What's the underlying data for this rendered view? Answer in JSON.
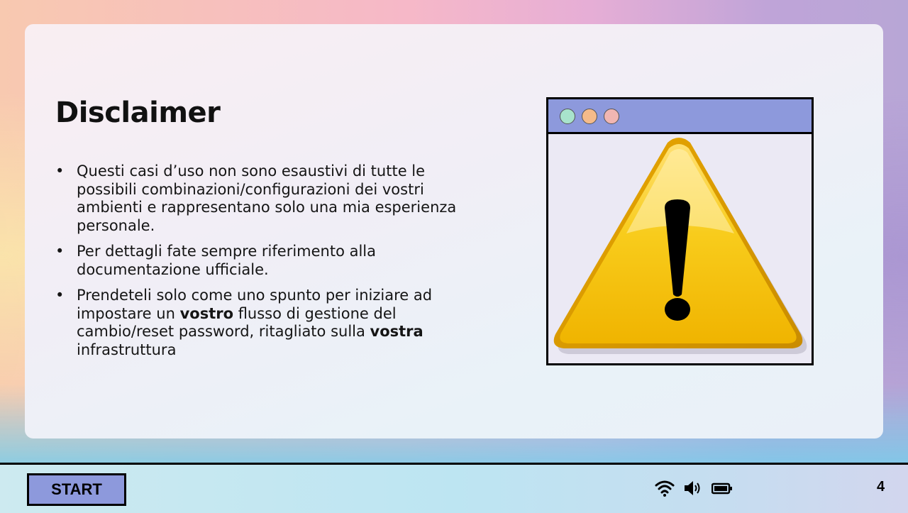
{
  "slide": {
    "title": "Disclaimer",
    "bullets": [
      {
        "parts": [
          {
            "text": "Questi casi d’uso non sono esaustivi di tutte le possibili combinazioni/configurazioni dei vostri ambienti e rappresentano solo una mia esperienza personale.",
            "bold": false
          }
        ]
      },
      {
        "parts": [
          {
            "text": "Per dettagli fate sempre riferimento alla documentazione ufficiale.",
            "bold": false
          }
        ]
      },
      {
        "parts": [
          {
            "text": "Prendeteli solo come uno spunto per iniziare ad impostare un ",
            "bold": false
          },
          {
            "text": "vostro",
            "bold": true
          },
          {
            "text": " flusso di gestione del cambio/reset password, ritagliato sulla ",
            "bold": false
          },
          {
            "text": "vostra",
            "bold": true
          },
          {
            "text": " infrastruttura",
            "bold": false
          }
        ]
      }
    ]
  },
  "illustration": {
    "window_dots": [
      "green-dot",
      "orange-dot",
      "pink-dot"
    ],
    "icon": "warning-icon",
    "colors": {
      "title_bar": "#8d99dc",
      "warning": "#f6c21a"
    }
  },
  "taskbar": {
    "start_label": "START",
    "tray_icons": [
      "wifi-icon",
      "speaker-icon",
      "battery-icon"
    ],
    "page_number": "4"
  }
}
